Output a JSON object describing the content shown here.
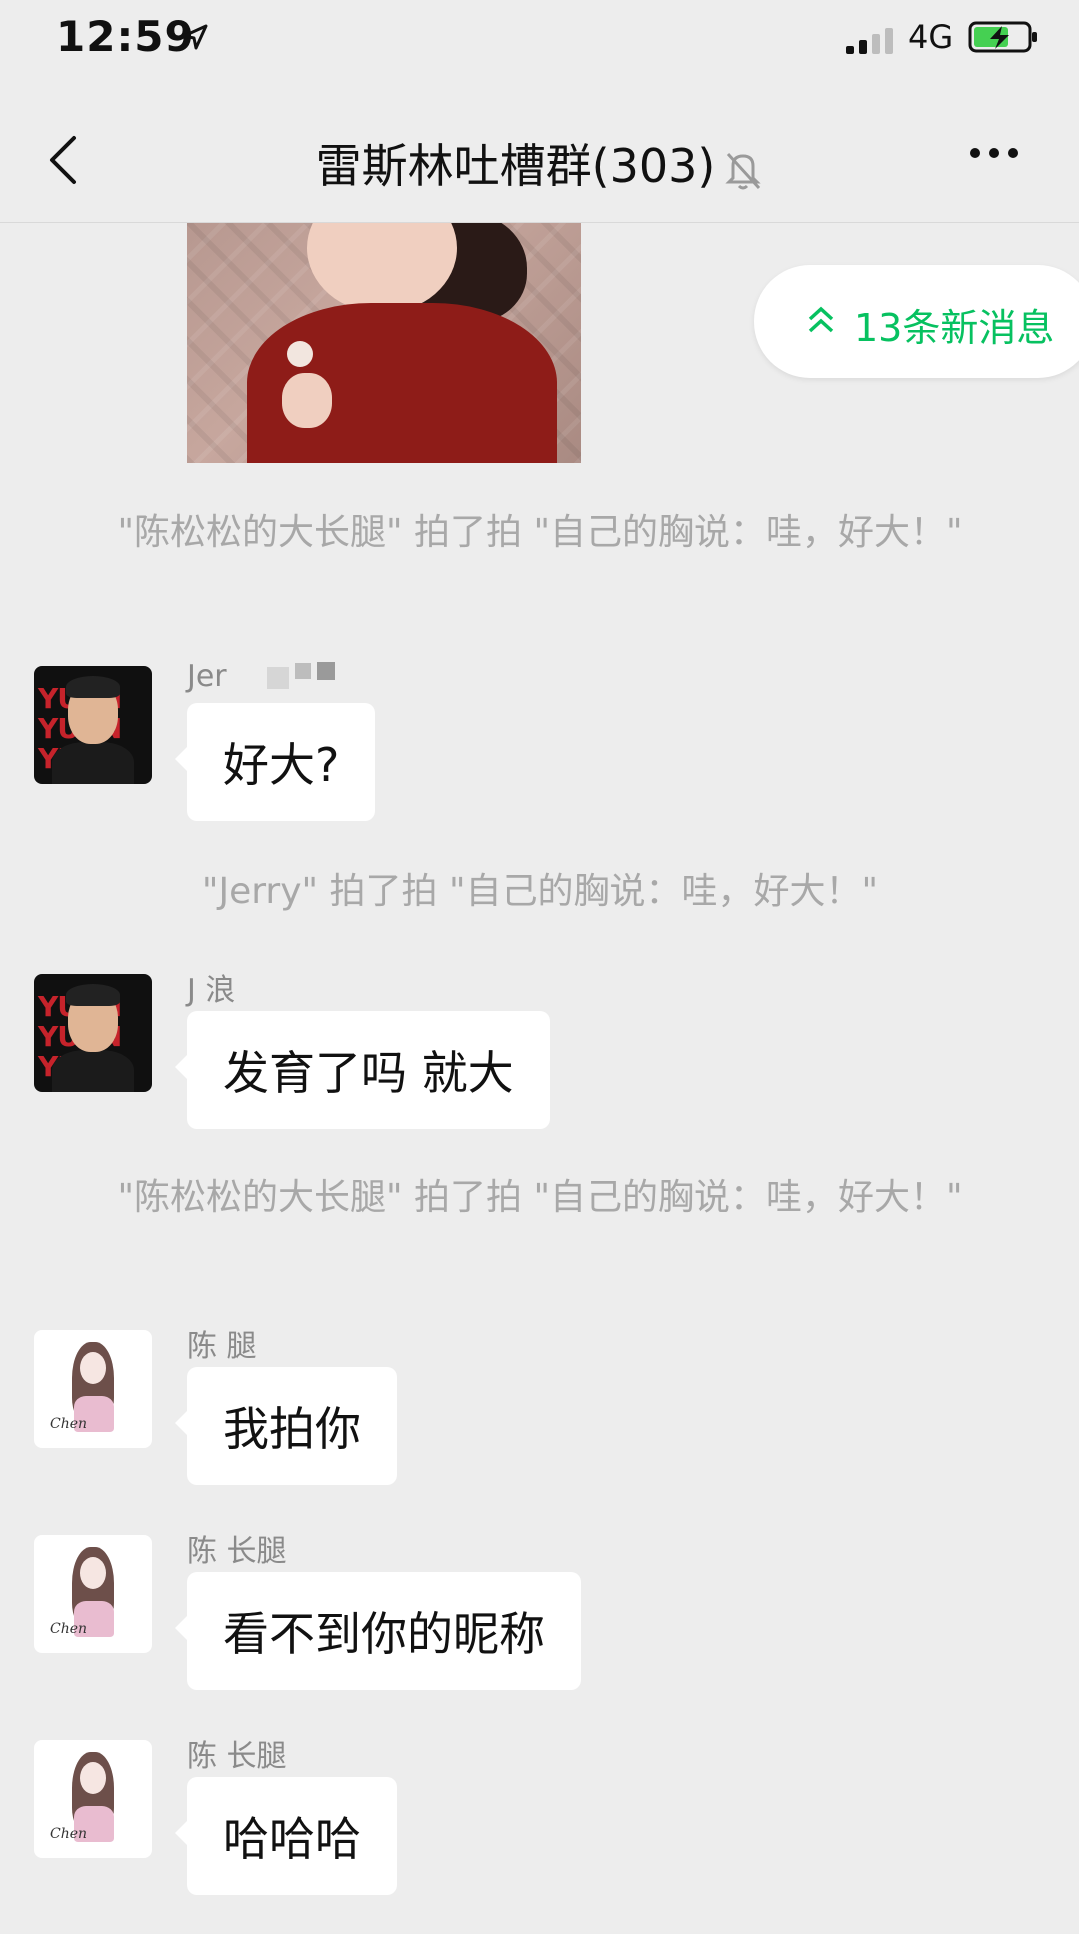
{
  "status": {
    "time": "12:59",
    "network": "4G"
  },
  "nav": {
    "title": "雷斯林吐槽群(303)"
  },
  "new_messages": {
    "label": "13条新消息"
  },
  "messages": [
    {
      "type": "system",
      "text": "\"陈松松的大长腿\" 拍了拍 \"自己的胸说：哇，好大！\""
    },
    {
      "sender": "Jer",
      "text": "好大?"
    },
    {
      "type": "system",
      "text": "\"Jerry\" 拍了拍 \"自己的胸说：哇，好大！\""
    },
    {
      "sender": "J 浪",
      "text": "发育了吗 就大"
    },
    {
      "type": "system",
      "text": "\"陈松松的大长腿\" 拍了拍 \"自己的胸说：哇，好大！\""
    },
    {
      "sender": "陈 腿",
      "text": "我拍你"
    },
    {
      "sender": "陈 长腿",
      "text": "看不到你的昵称"
    },
    {
      "sender": "陈 长腿",
      "text": "哈哈哈"
    }
  ]
}
